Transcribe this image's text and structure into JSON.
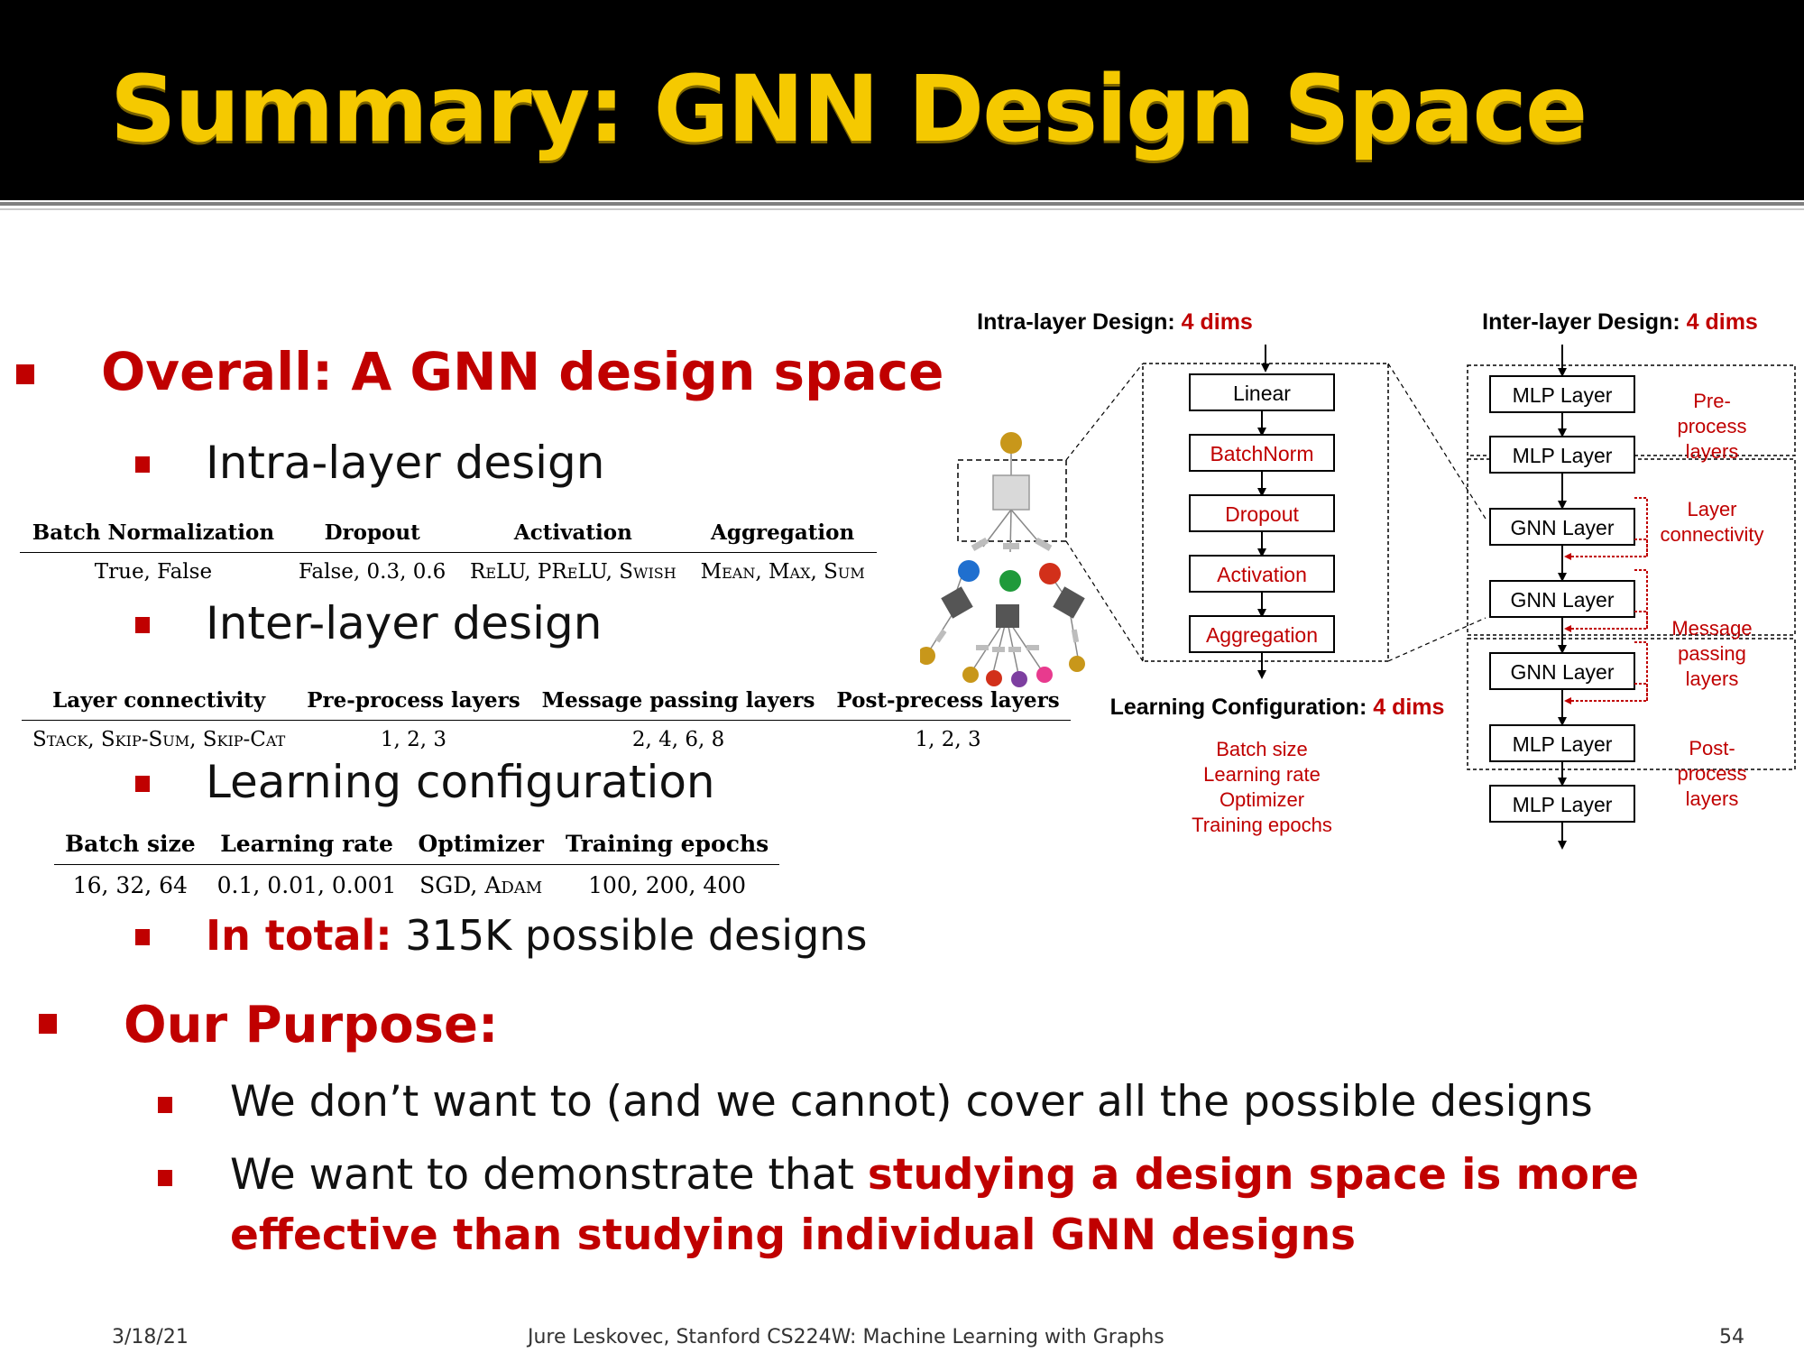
{
  "title": "Summary: GNN Design Space",
  "overall": {
    "heading": "Overall: A GNN design space"
  },
  "intra": {
    "heading": "Intra-layer design",
    "headers": [
      "Batch Normalization",
      "Dropout",
      "Activation",
      "Aggregation"
    ],
    "values": [
      "True, False",
      "False, 0.3, 0.6",
      "ReLU, PReLU, Swish",
      "Mean, Max, Sum"
    ]
  },
  "inter": {
    "heading": "Inter-layer design",
    "headers": [
      "Layer connectivity",
      "Pre-process layers",
      "Message passing layers",
      "Post-precess layers"
    ],
    "values": [
      "Stack, Skip-Sum, Skip-Cat",
      "1, 2, 3",
      "2, 4, 6, 8",
      "1, 2, 3"
    ]
  },
  "learning": {
    "heading": "Learning configuration",
    "headers": [
      "Batch size",
      "Learning rate",
      "Optimizer",
      "Training epochs"
    ],
    "values": [
      "16, 32, 64",
      "0.1, 0.01, 0.001",
      "SGD, Adam",
      "100, 200, 400"
    ]
  },
  "total": {
    "label": "In total:",
    "text": " 315K possible designs"
  },
  "purpose": {
    "heading": "Our Purpose:",
    "point1": "We don’t want to (and we cannot) cover all the possible designs",
    "point2_plain": "We want to demonstrate that ",
    "point2_red_line1": "studying a design space is more",
    "point2_red_line2": "effective than studying individual GNN designs"
  },
  "diagram": {
    "intra_title": "Intra-layer Design: ",
    "intra_dims": "4 dims",
    "inter_title": "Inter-layer Design: ",
    "inter_dims": "4 dims",
    "learning_title": "Learning Configuration: ",
    "learning_dims": "4 dims",
    "intra_blocks": [
      "Linear",
      "BatchNorm",
      "Dropout",
      "Activation",
      "Aggregation"
    ],
    "learning_items": [
      "Batch size",
      "Learning rate",
      "Optimizer",
      "Training epochs"
    ],
    "inter_blocks": [
      "MLP Layer",
      "MLP Layer",
      "GNN Layer",
      "GNN Layer",
      "GNN Layer",
      "MLP Layer",
      "MLP Layer"
    ],
    "side_labels": {
      "pre": [
        "Pre-",
        "process",
        "layers"
      ],
      "conn": [
        "Layer",
        "connectivity"
      ],
      "msg": [
        "Message",
        "passing",
        "layers"
      ],
      "post": [
        "Post-",
        "process",
        "layers"
      ]
    },
    "colors": {
      "red": "#c00000",
      "gold": "#c8971a",
      "blue": "#1f6fcf",
      "green": "#1f9a3a",
      "nodered": "#d2301a",
      "purple": "#7d3fa0",
      "pink": "#e83a8e"
    }
  },
  "footer": {
    "date": "3/18/21",
    "course": "Jure Leskovec, Stanford CS224W: Machine Learning with Graphs",
    "page": "54"
  }
}
